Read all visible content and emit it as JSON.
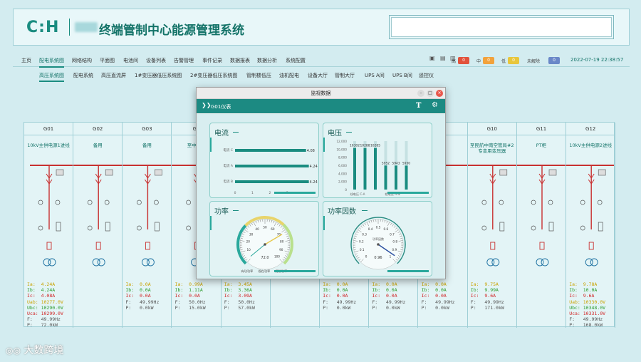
{
  "header": {
    "logo": "C:H",
    "title": "终端管制中心能源管理系统"
  },
  "nav": {
    "items": [
      "主页",
      "配电系统图",
      "网络结构",
      "平面图",
      "电池间",
      "设备列表",
      "告警管理",
      "事件记录",
      "数据报表",
      "数据分析",
      "系统配置"
    ],
    "active": "配电系统图"
  },
  "alarms": {
    "high_label": "高",
    "high_count": "0",
    "mid_label": "中",
    "mid_count": "0",
    "low_label": "低",
    "low_count": "0",
    "unresolved_label": "未解除",
    "unresolved_count": "0",
    "colors": {
      "high": "#e2523c",
      "mid": "#f2a23c",
      "low": "#e8c63c",
      "unresolved": "#6a88c8"
    }
  },
  "datetime": "2022-07-19 22:38:57",
  "subnav": {
    "items": [
      "高压系统图",
      "配电系统",
      "高压直流屏",
      "1#变压器低压系统图",
      "2#变压器低压系统图",
      "管制楼低压",
      "油机配电",
      "设备大厅",
      "管制大厅",
      "UPS A间",
      "UPS B间",
      "遥控仪"
    ],
    "active": "高压系统图"
  },
  "columns": [
    {
      "id": "G01",
      "name": "10kV主供电源1进线",
      "readings": [
        [
          "Ia:",
          "4.24A",
          "yellow"
        ],
        [
          "Ib:",
          "4.24A",
          "green"
        ],
        [
          "Ic:",
          "4.08A",
          "red"
        ],
        [
          "Uab:",
          "10277.0V",
          "yellow"
        ],
        [
          "Ubc:",
          "10290.0V",
          "green"
        ],
        [
          "Uca:",
          "10299.0V",
          "red"
        ],
        [
          "F:",
          "49.99Hz",
          "gray"
        ],
        [
          "P:",
          "72.0kW",
          "gray"
        ]
      ]
    },
    {
      "id": "G02",
      "name": "备用",
      "readings": []
    },
    {
      "id": "G03",
      "name": "备用",
      "readings": [
        [
          "Ia:",
          "0.0A",
          "yellow"
        ],
        [
          "Ib:",
          "0.0A",
          "green"
        ],
        [
          "Ic:",
          "0.0A",
          "red"
        ],
        [
          "F:",
          "49.99Hz",
          "gray"
        ],
        [
          "P:",
          "0.0kW",
          "gray"
        ]
      ]
    },
    {
      "id": "G0",
      "name": "至中高...",
      "readings": [
        [
          "Ia:",
          "0.99A",
          "yellow"
        ],
        [
          "Ib:",
          "1.11A",
          "green"
        ],
        [
          "Ic:",
          "0.0A",
          "red"
        ],
        [
          "F:",
          "50.0Hz",
          "gray"
        ],
        [
          "P:",
          "15.0kW",
          "gray"
        ]
      ]
    },
    {
      "id": "",
      "name": "",
      "readings": [
        [
          "Ia:",
          "3.45A",
          "yellow"
        ],
        [
          "Ib:",
          "3.36A",
          "green"
        ],
        [
          "Ic:",
          "3.09A",
          "red"
        ],
        [
          "F:",
          "50.0Hz",
          "gray"
        ],
        [
          "P:",
          "57.0kW",
          "gray"
        ]
      ]
    },
    {
      "id": "",
      "name": "",
      "readings": []
    },
    {
      "id": "",
      "name": "",
      "readings": [
        [
          "Ia:",
          "0.0A",
          "yellow"
        ],
        [
          "Ib:",
          "0.0A",
          "green"
        ],
        [
          "Ic:",
          "0.0A",
          "red"
        ],
        [
          "F:",
          "49.99Hz",
          "gray"
        ],
        [
          "P:",
          "0.0kW",
          "gray"
        ]
      ]
    },
    {
      "id": "",
      "name": "",
      "readings": [
        [
          "Ia:",
          "0.0A",
          "yellow"
        ],
        [
          "Ib:",
          "0.0A",
          "green"
        ],
        [
          "Ic:",
          "0.0A",
          "red"
        ],
        [
          "F:",
          "49.99Hz",
          "gray"
        ],
        [
          "P:",
          "0.0kW",
          "gray"
        ]
      ]
    },
    {
      "id": "",
      "name": "",
      "readings": [
        [
          "Ia:",
          "0.0A",
          "yellow"
        ],
        [
          "Ib:",
          "0.0A",
          "green"
        ],
        [
          "Ic:",
          "0.0A",
          "red"
        ],
        [
          "F:",
          "49.99Hz",
          "gray"
        ],
        [
          "P:",
          "0.0kW",
          "gray"
        ]
      ]
    },
    {
      "id": "G10",
      "name": "至民航中南空管局#2专变用变压器",
      "readings": [
        [
          "Ia:",
          "9.75A",
          "yellow"
        ],
        [
          "Ib:",
          "9.99A",
          "green"
        ],
        [
          "Ic:",
          "9.6A",
          "red"
        ],
        [
          "F:",
          "49.99Hz",
          "gray"
        ],
        [
          "P:",
          "171.0kW",
          "gray"
        ]
      ]
    },
    {
      "id": "G11",
      "name": "PT柜",
      "readings": []
    },
    {
      "id": "G12",
      "name": "10kV主供电源2进线",
      "readings": [
        [
          "Ia:",
          "9.78A",
          "yellow"
        ],
        [
          "Ib:",
          "10.0A",
          "green"
        ],
        [
          "Ic:",
          "9.6A",
          "red"
        ],
        [
          "Uab:",
          "10330.0V",
          "yellow"
        ],
        [
          "Ubc:",
          "10348.0V",
          "green"
        ],
        [
          "Uca:",
          "10331.0V",
          "red"
        ],
        [
          "F:",
          "49.99Hz",
          "gray"
        ],
        [
          "P:",
          "168.0kW",
          "gray"
        ]
      ]
    }
  ],
  "modal": {
    "title": "监视数据",
    "instrument": "G01仪表",
    "current_panel": {
      "title": "电流",
      "bars": [
        {
          "label": "电流 C",
          "value": 4.08
        },
        {
          "label": "电流 A",
          "value": 4.24
        },
        {
          "label": "电流 B",
          "value": 4.24
        }
      ],
      "value_labels": [
        "4.08",
        "4.24",
        "4.24"
      ],
      "ticks": [
        "0",
        "1",
        "2",
        "3"
      ]
    },
    "voltage_panel": {
      "title": "电压",
      "yticks": [
        "12,000",
        "10,000",
        "8,000",
        "6,000",
        "4,000",
        "2,000",
        "0"
      ],
      "values": [
        10302,
        10288,
        10285,
        5952,
        5943,
        5930
      ],
      "value_labels": [
        "10302",
        "10288",
        "10285",
        "5952",
        "5943",
        "5930"
      ],
      "xlabels": [
        "线电压 C-A",
        "相电压 A-N"
      ]
    },
    "power_panel": {
      "title": "功率",
      "gauge_labels": [
        "10",
        "20",
        "30",
        "40",
        "50",
        "60",
        "70",
        "80",
        "90",
        "100"
      ],
      "bottom_labels": [
        "有功功率",
        "视在功率",
        "无功功率"
      ],
      "reading": "72.0",
      "needle_fraction": 0.72
    },
    "pf_panel": {
      "title": "功率因数",
      "gauge_labels": [
        "0",
        "0.1",
        "0.2",
        "0.3",
        "0.4",
        "0.5",
        "0.6",
        "0.7",
        "0.8",
        "0.9",
        "1"
      ],
      "center_label": "功率因数",
      "reading": "0.96",
      "needle_fraction": 0.96
    }
  },
  "watermark": "大数跨境"
}
